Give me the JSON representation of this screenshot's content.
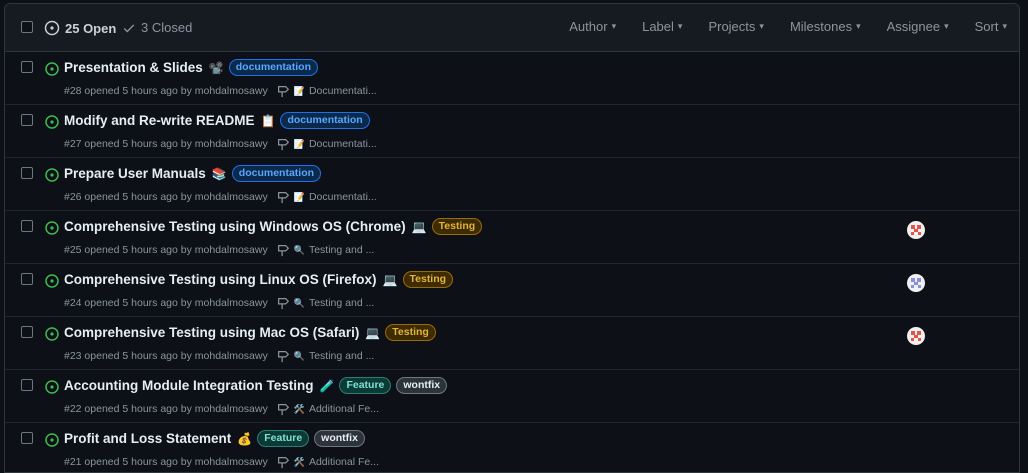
{
  "header": {
    "open_label": "25 Open",
    "closed_label": "3 Closed",
    "filters": [
      "Author",
      "Label",
      "Projects",
      "Milestones",
      "Assignee",
      "Sort"
    ]
  },
  "issues": [
    {
      "title": "Presentation & Slides",
      "emoji": "📽️",
      "labels": [
        {
          "name": "documentation",
          "bg": "#0b2a4a",
          "fg": "#58a6ff",
          "border": "#1f6feb"
        }
      ],
      "meta": "#28 opened 5 hours ago by mohdalmosawy",
      "milestone_emoji": "📝",
      "milestone": "Documentati...",
      "avatar": ""
    },
    {
      "title": "Modify and Re-write README",
      "emoji": "📋",
      "labels": [
        {
          "name": "documentation",
          "bg": "#0b2a4a",
          "fg": "#58a6ff",
          "border": "#1f6feb"
        }
      ],
      "meta": "#27 opened 5 hours ago by mohdalmosawy",
      "milestone_emoji": "📝",
      "milestone": "Documentati...",
      "avatar": ""
    },
    {
      "title": "Prepare User Manuals",
      "emoji": "📚",
      "labels": [
        {
          "name": "documentation",
          "bg": "#0b2a4a",
          "fg": "#58a6ff",
          "border": "#1f6feb"
        }
      ],
      "meta": "#26 opened 5 hours ago by mohdalmosawy",
      "milestone_emoji": "📝",
      "milestone": "Documentati...",
      "avatar": ""
    },
    {
      "title": "Comprehensive Testing using Windows OS (Chrome)",
      "emoji": "💻",
      "labels": [
        {
          "name": "Testing",
          "bg": "#3d2c00",
          "fg": "#e3b341",
          "border": "#9e6a03"
        }
      ],
      "meta": "#25 opened 5 hours ago by mohdalmosawy",
      "milestone_emoji": "🔍",
      "milestone": "Testing and ...",
      "avatar": "#e5534b"
    },
    {
      "title": "Comprehensive Testing using Linux OS (Firefox)",
      "emoji": "💻",
      "labels": [
        {
          "name": "Testing",
          "bg": "#3d2c00",
          "fg": "#e3b341",
          "border": "#9e6a03"
        }
      ],
      "meta": "#24 opened 5 hours ago by mohdalmosawy",
      "milestone_emoji": "🔍",
      "milestone": "Testing and ...",
      "avatar": "#8b8fd8"
    },
    {
      "title": "Comprehensive Testing using Mac OS (Safari)",
      "emoji": "💻",
      "labels": [
        {
          "name": "Testing",
          "bg": "#3d2c00",
          "fg": "#e3b341",
          "border": "#9e6a03"
        }
      ],
      "meta": "#23 opened 5 hours ago by mohdalmosawy",
      "milestone_emoji": "🔍",
      "milestone": "Testing and ...",
      "avatar": "#e5534b"
    },
    {
      "title": "Accounting Module Integration Testing",
      "emoji": "🧪",
      "labels": [
        {
          "name": "Feature",
          "bg": "#0c3a36",
          "fg": "#7ee2d2",
          "border": "#2a7f74"
        },
        {
          "name": "wontfix",
          "bg": "#2d333b",
          "fg": "#e6edf3",
          "border": "#6e7681"
        }
      ],
      "meta": "#22 opened 5 hours ago by mohdalmosawy",
      "milestone_emoji": "🛠️",
      "milestone": "Additional Fe...",
      "avatar": ""
    },
    {
      "title": "Profit and Loss Statement",
      "emoji": "💰",
      "labels": [
        {
          "name": "Feature",
          "bg": "#0c3a36",
          "fg": "#7ee2d2",
          "border": "#2a7f74"
        },
        {
          "name": "wontfix",
          "bg": "#2d333b",
          "fg": "#e6edf3",
          "border": "#6e7681"
        }
      ],
      "meta": "#21 opened 5 hours ago by mohdalmosawy",
      "milestone_emoji": "🛠️",
      "milestone": "Additional Fe...",
      "avatar": ""
    }
  ]
}
